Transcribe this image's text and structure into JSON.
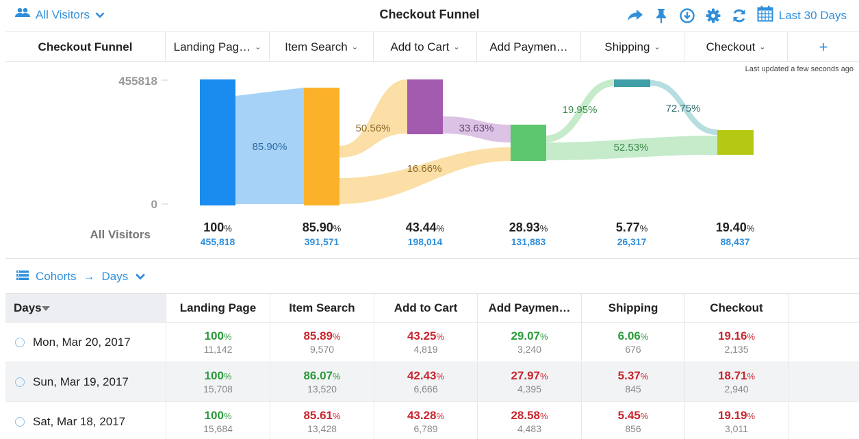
{
  "header": {
    "segment_label": "All Visitors",
    "title": "Checkout Funnel",
    "date_range": "Last 30 Days",
    "icons": [
      "share-icon",
      "pin-icon",
      "download-icon",
      "gear-icon",
      "refresh-icon",
      "calendar-icon"
    ]
  },
  "steps": {
    "first": "Checkout Funnel",
    "items": [
      "Landing Pag…",
      "Item Search",
      "Add to Cart",
      "Add Paymen…",
      "Shipping",
      "Checkout"
    ],
    "add_label": "+"
  },
  "updated": "Last updated a few seconds ago",
  "chart_data": {
    "type": "sankey",
    "y_max_label": "455818",
    "y_min_label": "0",
    "ylim": [
      0,
      455818
    ],
    "nodes": [
      {
        "name": "Landing Page",
        "value": 455818,
        "color": "#1a8cf0"
      },
      {
        "name": "Item Search",
        "value": 391571,
        "color": "#fbb12a"
      },
      {
        "name": "Add to Cart",
        "value": 198014,
        "color": "#a35bb0"
      },
      {
        "name": "Add Payment",
        "value": 131883,
        "color": "#5dc76f"
      },
      {
        "name": "Shipping",
        "value": 26317,
        "color": "#3f9ea6"
      },
      {
        "name": "Checkout",
        "value": 88437,
        "color": "#b5c913"
      }
    ],
    "flows": [
      {
        "from": "Landing Page",
        "to": "Item Search",
        "label": "85.90%"
      },
      {
        "from": "Item Search",
        "to": "Add to Cart",
        "label": "50.56%"
      },
      {
        "from": "Item Search",
        "to": "Add Payment",
        "label": "16.66%"
      },
      {
        "from": "Add to Cart",
        "to": "Add Payment",
        "label": "33.63%"
      },
      {
        "from": "Add Payment",
        "to": "Shipping",
        "label": "19.95%"
      },
      {
        "from": "Shipping",
        "to": "Checkout",
        "label": "72.75%"
      },
      {
        "from": "Add Payment",
        "to": "Checkout",
        "label": "52.53%"
      }
    ]
  },
  "summary": {
    "label": "All Visitors",
    "cols": [
      {
        "pct": "100",
        "count": "455,818"
      },
      {
        "pct": "85.90",
        "count": "391,571"
      },
      {
        "pct": "43.44",
        "count": "198,014"
      },
      {
        "pct": "28.93",
        "count": "131,883"
      },
      {
        "pct": "5.77",
        "count": "26,317"
      },
      {
        "pct": "19.40",
        "count": "88,437"
      }
    ]
  },
  "cohorts": {
    "label": "Cohorts",
    "arrow": "→",
    "unit": "Days"
  },
  "table": {
    "columns": [
      "Days",
      "Landing Page",
      "Item Search",
      "Add to Cart",
      "Add Paymen…",
      "Shipping",
      "Checkout"
    ],
    "rows": [
      {
        "date": "Mon, Mar 20, 2017",
        "cells": [
          {
            "pct": "100",
            "count": "11,142",
            "trend": "up"
          },
          {
            "pct": "85.89",
            "count": "9,570",
            "trend": "down"
          },
          {
            "pct": "43.25",
            "count": "4,819",
            "trend": "down"
          },
          {
            "pct": "29.07",
            "count": "3,240",
            "trend": "up"
          },
          {
            "pct": "6.06",
            "count": "676",
            "trend": "up"
          },
          {
            "pct": "19.16",
            "count": "2,135",
            "trend": "down"
          }
        ]
      },
      {
        "date": "Sun, Mar 19, 2017",
        "cells": [
          {
            "pct": "100",
            "count": "15,708",
            "trend": "up"
          },
          {
            "pct": "86.07",
            "count": "13,520",
            "trend": "up"
          },
          {
            "pct": "42.43",
            "count": "6,666",
            "trend": "down"
          },
          {
            "pct": "27.97",
            "count": "4,395",
            "trend": "down"
          },
          {
            "pct": "5.37",
            "count": "845",
            "trend": "down"
          },
          {
            "pct": "18.71",
            "count": "2,940",
            "trend": "down"
          }
        ]
      },
      {
        "date": "Sat, Mar 18, 2017",
        "cells": [
          {
            "pct": "100",
            "count": "15,684",
            "trend": "up"
          },
          {
            "pct": "85.61",
            "count": "13,428",
            "trend": "down"
          },
          {
            "pct": "43.28",
            "count": "6,789",
            "trend": "down"
          },
          {
            "pct": "28.58",
            "count": "4,483",
            "trend": "down"
          },
          {
            "pct": "5.45",
            "count": "856",
            "trend": "down"
          },
          {
            "pct": "19.19",
            "count": "3,011",
            "trend": "down"
          }
        ]
      }
    ]
  }
}
